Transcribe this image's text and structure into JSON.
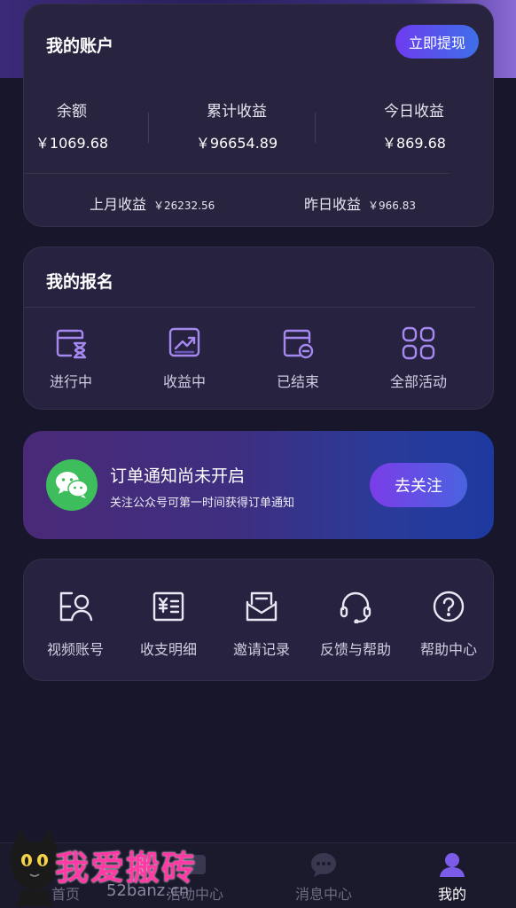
{
  "account": {
    "title": "我的账户",
    "withdraw_label": "立即提现",
    "balance_label": "余额",
    "balance_value": "￥1069.68",
    "total_label": "累计收益",
    "total_value": "￥96654.89",
    "today_label": "今日收益",
    "today_value": "￥869.68",
    "last_month_label": "上月收益",
    "last_month_value": "￥26232.56",
    "yesterday_label": "昨日收益",
    "yesterday_value": "￥966.83"
  },
  "registration": {
    "title": "我的报名",
    "items": [
      {
        "label": "进行中",
        "icon": "hourglass-calendar-icon"
      },
      {
        "label": "收益中",
        "icon": "trend-chart-icon"
      },
      {
        "label": "已结束",
        "icon": "calendar-minus-icon"
      },
      {
        "label": "全部活动",
        "icon": "grid-apps-icon"
      }
    ]
  },
  "notify": {
    "title": "订单通知尚未开启",
    "subtitle": "关注公众号可第一时间获得订单通知",
    "button_label": "去关注",
    "icon": "wechat-icon",
    "icon_color": "#3ebd5c"
  },
  "tools": {
    "items": [
      {
        "label": "视频账号",
        "icon": "video-account-icon"
      },
      {
        "label": "收支明细",
        "icon": "ledger-icon"
      },
      {
        "label": "邀请记录",
        "icon": "invite-envelope-icon"
      },
      {
        "label": "反馈与帮助",
        "icon": "headset-icon"
      },
      {
        "label": "帮助中心",
        "icon": "question-icon"
      }
    ]
  },
  "tabbar": {
    "items": [
      {
        "label": "首页",
        "icon": "home-icon",
        "active": false
      },
      {
        "label": "活动中心",
        "icon": "activity-icon",
        "active": false
      },
      {
        "label": "消息中心",
        "icon": "message-icon",
        "active": false
      },
      {
        "label": "我的",
        "icon": "user-icon",
        "active": true
      }
    ]
  },
  "watermark": {
    "text": "我爱搬砖",
    "url": "52banz.cn"
  },
  "colors": {
    "background": "#17162a",
    "card": "#262240",
    "accent_purple": "#6d3cf0",
    "accent_blue": "#3e6fe8",
    "icon_purple": "#a689f0"
  }
}
